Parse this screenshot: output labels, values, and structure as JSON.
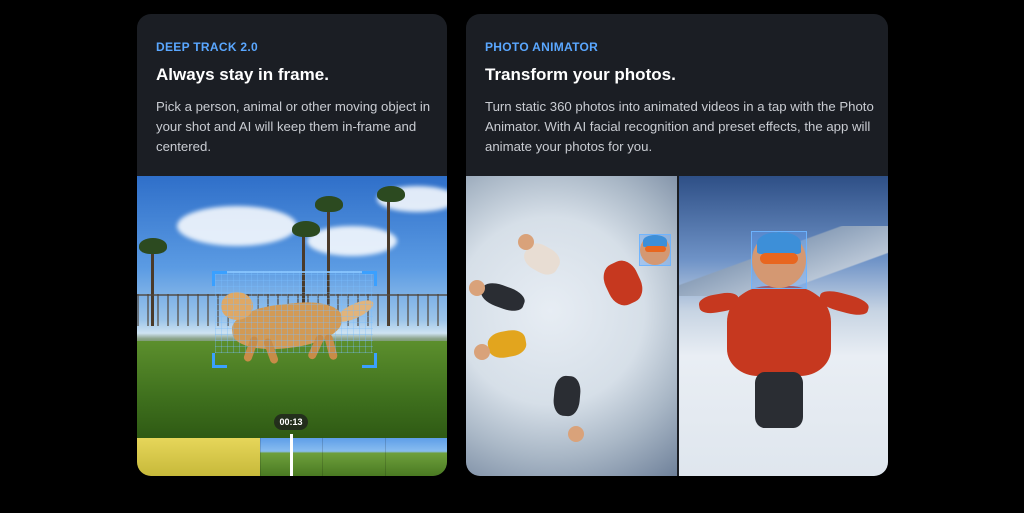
{
  "cards": [
    {
      "tag": "DEEP TRACK 2.0",
      "title": "Always stay in frame.",
      "description": "Pick a person, animal or other moving object in your shot and AI will keep them in-frame and centered.",
      "timestamp": "00:13"
    },
    {
      "tag": "PHOTO ANIMATOR",
      "title": "Transform your photos.",
      "description": "Turn static 360 photos into animated videos in a tap with the Photo Animator. With AI facial recognition and preset effects, the app will animate your photos for you."
    }
  ],
  "colors": {
    "background": "#000000",
    "card": "#1b1e24",
    "tag": "#5aa7ff",
    "tracking": "#3aa0ff"
  }
}
